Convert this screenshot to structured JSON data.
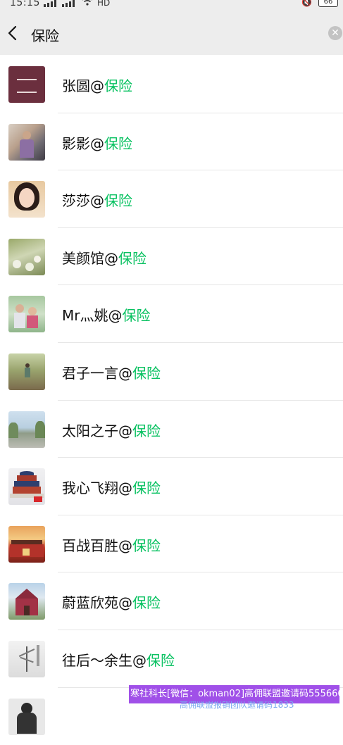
{
  "status_bar": {
    "time": "15:15",
    "network": "HD",
    "battery": "66"
  },
  "search": {
    "query": "保险",
    "accent": "#07c160"
  },
  "results": [
    {
      "name": "张圆@",
      "keyword": "保险",
      "avatar_icon": "book-cover-avatar"
    },
    {
      "name": "影影@",
      "keyword": "保险",
      "avatar_icon": "person-photo-avatar"
    },
    {
      "name": "莎莎@",
      "keyword": "保险",
      "avatar_icon": "woman-portrait-avatar"
    },
    {
      "name": "美颜馆@",
      "keyword": "保险",
      "avatar_icon": "flowers-photo-avatar"
    },
    {
      "name": "Mr灬姚@",
      "keyword": "保险",
      "avatar_icon": "family-photo-avatar"
    },
    {
      "name": "君子一言@",
      "keyword": "保险",
      "avatar_icon": "landscape-person-avatar"
    },
    {
      "name": "太阳之子@",
      "keyword": "保险",
      "avatar_icon": "road-trees-avatar"
    },
    {
      "name": "我心飞翔@",
      "keyword": "保险",
      "avatar_icon": "temple-of-heaven-avatar"
    },
    {
      "name": "百战百胜@",
      "keyword": "保险",
      "avatar_icon": "tiananmen-avatar"
    },
    {
      "name": "蔚蓝欣苑@",
      "keyword": "保险",
      "avatar_icon": "red-house-avatar"
    },
    {
      "name": "往后～余生@",
      "keyword": "保险",
      "avatar_icon": "winter-tree-avatar"
    },
    {
      "name": "",
      "keyword": "",
      "avatar_icon": "person-silhouette-avatar"
    }
  ],
  "watermark": {
    "line1": "寒社科长[微信：okman02]高佣联盟邀请码555666",
    "line2": "高佣联盟报销团队邀请码1833"
  }
}
